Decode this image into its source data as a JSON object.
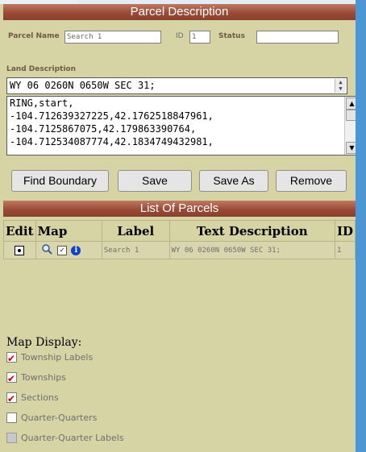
{
  "parcel_description": {
    "header": "Parcel Description",
    "parcel_name_label": "Parcel Name",
    "parcel_name_value": "Search 1",
    "id_label": "ID",
    "id_value": "1",
    "status_label": "Status",
    "status_value": "",
    "land_description_label": "Land Description",
    "land_description_value": "WY 06 0260N 0650W SEC 31;",
    "ring_lines": [
      "RING,start,",
      "-104.712639327225,42.1762518847961,",
      "-104.7125867075,42.179863390764,",
      "-104.712534087774,42.1834749432981,"
    ],
    "buttons": {
      "find_boundary": "Find Boundary",
      "save": "Save",
      "save_as": "Save As",
      "remove": "Remove"
    }
  },
  "list_of_parcels": {
    "header": "List Of Parcels",
    "columns": [
      "Edit",
      "Map",
      "Label",
      "Text Description",
      "ID"
    ],
    "rows": [
      {
        "label": "Search 1",
        "text_description": "WY 06 0260N 0650W SEC 31;",
        "id": "1"
      }
    ]
  },
  "map_display": {
    "title": "Map Display:",
    "options": [
      {
        "label": "Township Labels",
        "state": "checked"
      },
      {
        "label": "Townships",
        "state": "checked"
      },
      {
        "label": "Sections",
        "state": "checked"
      },
      {
        "label": "Quarter-Quarters",
        "state": "unchecked"
      },
      {
        "label": "Quarter-Quarter Labels",
        "state": "disabled"
      }
    ]
  },
  "colors": {
    "panel_background": "#d6d3a5",
    "header_background": "#9a4b38",
    "check_mark": "#d00000",
    "right_strip": "#4b97d6"
  },
  "icons": [
    "magnifier-icon",
    "checkbox-icon",
    "info-icon"
  ]
}
